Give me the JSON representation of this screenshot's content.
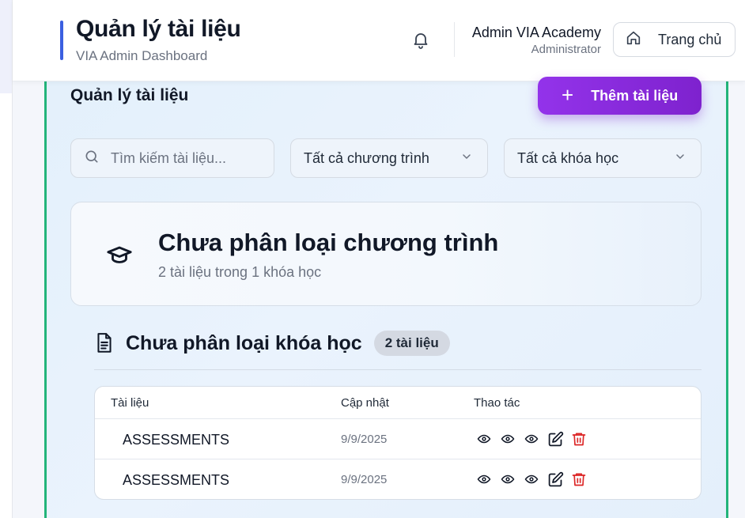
{
  "header": {
    "title": "Quản lý tài liệu",
    "subtitle": "VIA Admin Dashboard",
    "user_name": "Admin VIA Academy",
    "user_role": "Administrator",
    "home_label": "Trang chủ"
  },
  "main": {
    "section_title": "Quản lý tài liệu",
    "add_button_label": "Thêm tài liệu",
    "search_placeholder": "Tìm kiếm tài liệu...",
    "program_filter": "Tất cả chương trình",
    "course_filter": "Tất cả khóa học",
    "program": {
      "title": "Chưa phân loại chương trình",
      "meta": "2 tài liệu trong 1 khóa học"
    },
    "course": {
      "title": "Chưa phân loại khóa học",
      "badge": "2 tài liệu"
    },
    "table": {
      "columns": [
        "Tài liệu",
        "Cập nhật",
        "Thao tác"
      ],
      "rows": [
        {
          "name": "ASSESSMENTS",
          "updated": "9/9/2025"
        },
        {
          "name": "ASSESSMENTS",
          "updated": "9/9/2025"
        }
      ]
    }
  },
  "colors": {
    "accent": "#3b5fe0",
    "card_border": "#22b47a",
    "primary_button": "#9333ea",
    "delete": "#dc2626"
  },
  "icons": [
    "bell-icon",
    "home-icon",
    "plus-icon",
    "search-icon",
    "chevron-down-icon",
    "graduation-cap-icon",
    "document-icon",
    "eye-icon",
    "edit-icon",
    "trash-icon"
  ]
}
